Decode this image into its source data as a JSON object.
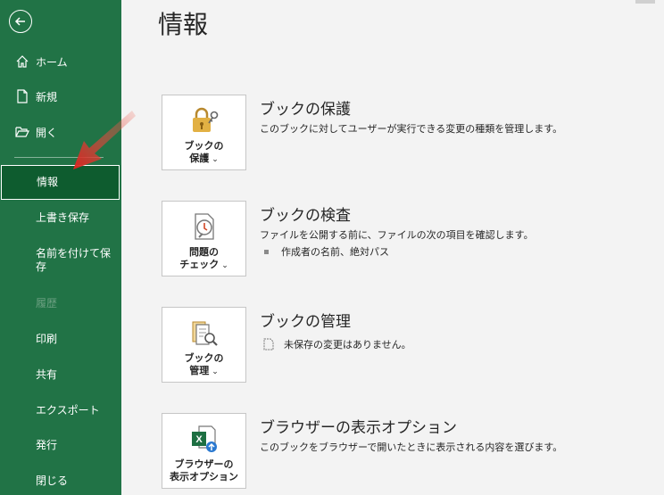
{
  "sidebar": {
    "top_items": [
      {
        "label": "ホーム",
        "icon": "home-icon"
      },
      {
        "label": "新規",
        "icon": "new-document-icon"
      },
      {
        "label": "開く",
        "icon": "open-folder-icon"
      }
    ],
    "items": [
      {
        "label": "情報",
        "selected": true
      },
      {
        "label": "上書き保存"
      },
      {
        "label": "名前を付けて保存"
      },
      {
        "label": "履歴",
        "disabled": true
      },
      {
        "label": "印刷"
      },
      {
        "label": "共有"
      },
      {
        "label": "エクスポート"
      },
      {
        "label": "発行"
      },
      {
        "label": "閉じる"
      }
    ]
  },
  "main": {
    "title": "情報",
    "sections": [
      {
        "tile_line1": "ブックの",
        "tile_line2": "保護",
        "title": "ブックの保護",
        "description": "このブックに対してユーザーが実行できる変更の種類を管理します。"
      },
      {
        "tile_line1": "問題の",
        "tile_line2": "チェック",
        "title": "ブックの検査",
        "description": "ファイルを公開する前に、ファイルの次の項目を確認します。",
        "bullet": "作成者の名前、絶対パス"
      },
      {
        "tile_line1": "ブックの",
        "tile_line2": "管理",
        "title": "ブックの管理",
        "note": "未保存の変更はありません。"
      },
      {
        "tile_line1": "ブラウザーの",
        "tile_line2": "表示オプション",
        "title": "ブラウザーの表示オプション",
        "description": "このブックをブラウザーで開いたときに表示される内容を選びます。"
      }
    ]
  },
  "colors": {
    "sidebar_bg": "#217346",
    "selected_bg": "#0e5c2f",
    "annotation_arrow": "#d9231f"
  }
}
